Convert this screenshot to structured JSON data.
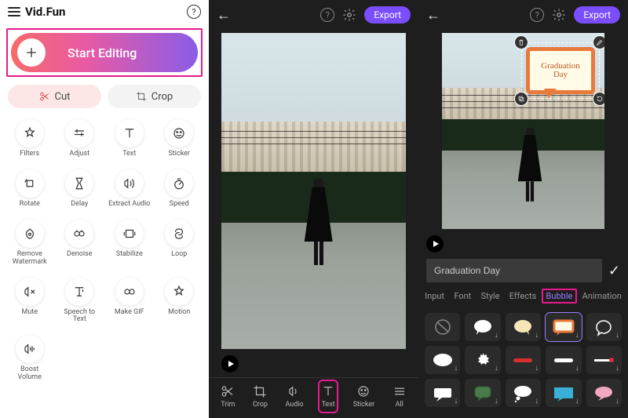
{
  "app": {
    "title": "Vid.Fun"
  },
  "start": {
    "label": "Start Editing"
  },
  "quick": {
    "cut": "Cut",
    "crop": "Crop"
  },
  "tools": [
    {
      "id": "filters",
      "label": "Filters"
    },
    {
      "id": "adjust",
      "label": "Adjust"
    },
    {
      "id": "text",
      "label": "Text"
    },
    {
      "id": "sticker",
      "label": "Sticker"
    },
    {
      "id": "rotate",
      "label": "Rotate"
    },
    {
      "id": "delay",
      "label": "Delay"
    },
    {
      "id": "extract-audio",
      "label": "Extract Audio"
    },
    {
      "id": "speed",
      "label": "Speed"
    },
    {
      "id": "remove-watermark",
      "label": "Remove Watermark"
    },
    {
      "id": "denoise",
      "label": "Denoise"
    },
    {
      "id": "stabilize",
      "label": "Stabilize"
    },
    {
      "id": "loop",
      "label": "Loop"
    },
    {
      "id": "mute",
      "label": "Mute"
    },
    {
      "id": "speech-to-text",
      "label": "Speech to Text"
    },
    {
      "id": "make-gif",
      "label": "Make GIF"
    },
    {
      "id": "motion",
      "label": "Motion"
    },
    {
      "id": "boost-volume",
      "label": "Boost Volume"
    }
  ],
  "editor": {
    "export": "Export",
    "bottom": [
      {
        "id": "trim",
        "label": "Trim"
      },
      {
        "id": "crop",
        "label": "Crop"
      },
      {
        "id": "audio",
        "label": "Audio"
      },
      {
        "id": "text",
        "label": "Text"
      },
      {
        "id": "sticker",
        "label": "Sticker"
      },
      {
        "id": "all",
        "label": "All"
      }
    ],
    "selected": "text"
  },
  "textPanel": {
    "overlayText1": "Graduation",
    "overlayText2": "Day",
    "inputValue": "Graduation Day",
    "tabs": [
      "Input",
      "Font",
      "Style",
      "Effects",
      "Bubble",
      "Animation"
    ],
    "activeTab": "Bubble"
  }
}
